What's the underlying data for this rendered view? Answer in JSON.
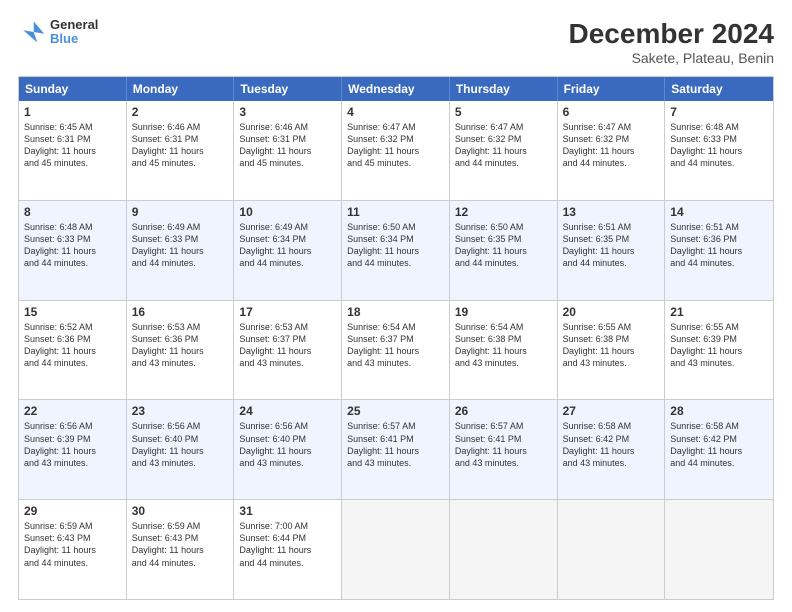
{
  "header": {
    "logo": {
      "line1": "General",
      "line2": "Blue"
    },
    "title": "December 2024",
    "subtitle": "Sakete, Plateau, Benin"
  },
  "weekdays": [
    "Sunday",
    "Monday",
    "Tuesday",
    "Wednesday",
    "Thursday",
    "Friday",
    "Saturday"
  ],
  "rows": [
    {
      "alt": false,
      "cells": [
        {
          "day": "1",
          "lines": [
            "Sunrise: 6:45 AM",
            "Sunset: 6:31 PM",
            "Daylight: 11 hours",
            "and 45 minutes."
          ]
        },
        {
          "day": "2",
          "lines": [
            "Sunrise: 6:46 AM",
            "Sunset: 6:31 PM",
            "Daylight: 11 hours",
            "and 45 minutes."
          ]
        },
        {
          "day": "3",
          "lines": [
            "Sunrise: 6:46 AM",
            "Sunset: 6:31 PM",
            "Daylight: 11 hours",
            "and 45 minutes."
          ]
        },
        {
          "day": "4",
          "lines": [
            "Sunrise: 6:47 AM",
            "Sunset: 6:32 PM",
            "Daylight: 11 hours",
            "and 45 minutes."
          ]
        },
        {
          "day": "5",
          "lines": [
            "Sunrise: 6:47 AM",
            "Sunset: 6:32 PM",
            "Daylight: 11 hours",
            "and 44 minutes."
          ]
        },
        {
          "day": "6",
          "lines": [
            "Sunrise: 6:47 AM",
            "Sunset: 6:32 PM",
            "Daylight: 11 hours",
            "and 44 minutes."
          ]
        },
        {
          "day": "7",
          "lines": [
            "Sunrise: 6:48 AM",
            "Sunset: 6:33 PM",
            "Daylight: 11 hours",
            "and 44 minutes."
          ]
        }
      ]
    },
    {
      "alt": true,
      "cells": [
        {
          "day": "8",
          "lines": [
            "Sunrise: 6:48 AM",
            "Sunset: 6:33 PM",
            "Daylight: 11 hours",
            "and 44 minutes."
          ]
        },
        {
          "day": "9",
          "lines": [
            "Sunrise: 6:49 AM",
            "Sunset: 6:33 PM",
            "Daylight: 11 hours",
            "and 44 minutes."
          ]
        },
        {
          "day": "10",
          "lines": [
            "Sunrise: 6:49 AM",
            "Sunset: 6:34 PM",
            "Daylight: 11 hours",
            "and 44 minutes."
          ]
        },
        {
          "day": "11",
          "lines": [
            "Sunrise: 6:50 AM",
            "Sunset: 6:34 PM",
            "Daylight: 11 hours",
            "and 44 minutes."
          ]
        },
        {
          "day": "12",
          "lines": [
            "Sunrise: 6:50 AM",
            "Sunset: 6:35 PM",
            "Daylight: 11 hours",
            "and 44 minutes."
          ]
        },
        {
          "day": "13",
          "lines": [
            "Sunrise: 6:51 AM",
            "Sunset: 6:35 PM",
            "Daylight: 11 hours",
            "and 44 minutes."
          ]
        },
        {
          "day": "14",
          "lines": [
            "Sunrise: 6:51 AM",
            "Sunset: 6:36 PM",
            "Daylight: 11 hours",
            "and 44 minutes."
          ]
        }
      ]
    },
    {
      "alt": false,
      "cells": [
        {
          "day": "15",
          "lines": [
            "Sunrise: 6:52 AM",
            "Sunset: 6:36 PM",
            "Daylight: 11 hours",
            "and 44 minutes."
          ]
        },
        {
          "day": "16",
          "lines": [
            "Sunrise: 6:53 AM",
            "Sunset: 6:36 PM",
            "Daylight: 11 hours",
            "and 43 minutes."
          ]
        },
        {
          "day": "17",
          "lines": [
            "Sunrise: 6:53 AM",
            "Sunset: 6:37 PM",
            "Daylight: 11 hours",
            "and 43 minutes."
          ]
        },
        {
          "day": "18",
          "lines": [
            "Sunrise: 6:54 AM",
            "Sunset: 6:37 PM",
            "Daylight: 11 hours",
            "and 43 minutes."
          ]
        },
        {
          "day": "19",
          "lines": [
            "Sunrise: 6:54 AM",
            "Sunset: 6:38 PM",
            "Daylight: 11 hours",
            "and 43 minutes."
          ]
        },
        {
          "day": "20",
          "lines": [
            "Sunrise: 6:55 AM",
            "Sunset: 6:38 PM",
            "Daylight: 11 hours",
            "and 43 minutes."
          ]
        },
        {
          "day": "21",
          "lines": [
            "Sunrise: 6:55 AM",
            "Sunset: 6:39 PM",
            "Daylight: 11 hours",
            "and 43 minutes."
          ]
        }
      ]
    },
    {
      "alt": true,
      "cells": [
        {
          "day": "22",
          "lines": [
            "Sunrise: 6:56 AM",
            "Sunset: 6:39 PM",
            "Daylight: 11 hours",
            "and 43 minutes."
          ]
        },
        {
          "day": "23",
          "lines": [
            "Sunrise: 6:56 AM",
            "Sunset: 6:40 PM",
            "Daylight: 11 hours",
            "and 43 minutes."
          ]
        },
        {
          "day": "24",
          "lines": [
            "Sunrise: 6:56 AM",
            "Sunset: 6:40 PM",
            "Daylight: 11 hours",
            "and 43 minutes."
          ]
        },
        {
          "day": "25",
          "lines": [
            "Sunrise: 6:57 AM",
            "Sunset: 6:41 PM",
            "Daylight: 11 hours",
            "and 43 minutes."
          ]
        },
        {
          "day": "26",
          "lines": [
            "Sunrise: 6:57 AM",
            "Sunset: 6:41 PM",
            "Daylight: 11 hours",
            "and 43 minutes."
          ]
        },
        {
          "day": "27",
          "lines": [
            "Sunrise: 6:58 AM",
            "Sunset: 6:42 PM",
            "Daylight: 11 hours",
            "and 43 minutes."
          ]
        },
        {
          "day": "28",
          "lines": [
            "Sunrise: 6:58 AM",
            "Sunset: 6:42 PM",
            "Daylight: 11 hours",
            "and 44 minutes."
          ]
        }
      ]
    },
    {
      "alt": false,
      "cells": [
        {
          "day": "29",
          "lines": [
            "Sunrise: 6:59 AM",
            "Sunset: 6:43 PM",
            "Daylight: 11 hours",
            "and 44 minutes."
          ]
        },
        {
          "day": "30",
          "lines": [
            "Sunrise: 6:59 AM",
            "Sunset: 6:43 PM",
            "Daylight: 11 hours",
            "and 44 minutes."
          ]
        },
        {
          "day": "31",
          "lines": [
            "Sunrise: 7:00 AM",
            "Sunset: 6:44 PM",
            "Daylight: 11 hours",
            "and 44 minutes."
          ]
        },
        {
          "day": "",
          "lines": []
        },
        {
          "day": "",
          "lines": []
        },
        {
          "day": "",
          "lines": []
        },
        {
          "day": "",
          "lines": []
        }
      ]
    }
  ]
}
